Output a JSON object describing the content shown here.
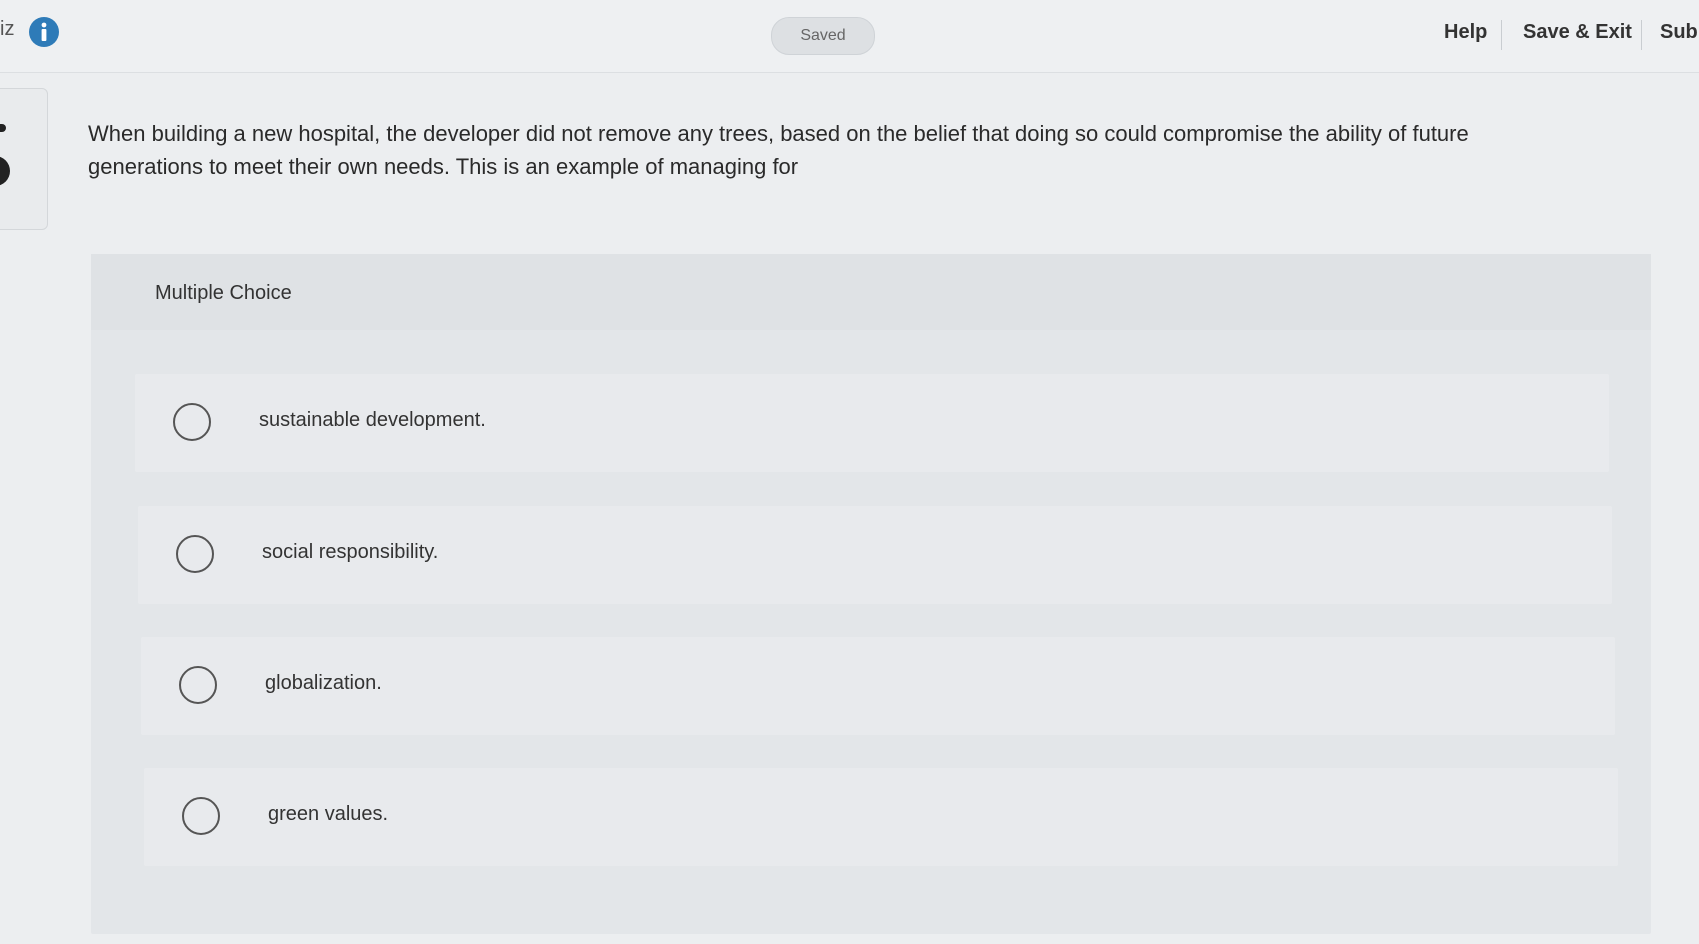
{
  "header": {
    "quiz_fragment": "iz",
    "info_icon": "info-circle-icon",
    "status": "Saved",
    "help_label": "Help",
    "save_exit_label": "Save & Exit",
    "submit_fragment": "Sub"
  },
  "question": {
    "text": "When building a new hospital, the developer did not remove any trees, based on the belief that doing so could compromise the ability of future generations to meet their own needs. This is an example of managing for"
  },
  "answer_area": {
    "type_label": "Multiple Choice",
    "options": [
      {
        "label": "sustainable development.",
        "selected": false
      },
      {
        "label": "social responsibility.",
        "selected": false
      },
      {
        "label": "globalization.",
        "selected": false
      },
      {
        "label": "green values.",
        "selected": false
      }
    ]
  },
  "colors": {
    "background": "#eceef0",
    "info_icon": "#2e7bb8",
    "text": "#2b2b2b"
  }
}
